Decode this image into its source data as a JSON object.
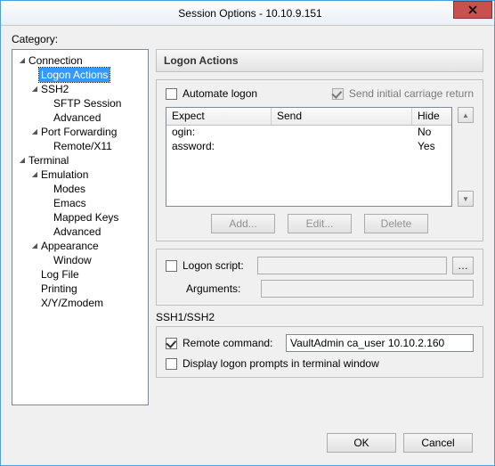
{
  "window": {
    "title": "Session Options - 10.10.9.151"
  },
  "category_label": "Category:",
  "tree": [
    {
      "label": "Connection",
      "level": 0,
      "arrow": "down"
    },
    {
      "label": "Logon Actions",
      "level": 1,
      "arrow": "",
      "selected": true
    },
    {
      "label": "SSH2",
      "level": 1,
      "arrow": "down"
    },
    {
      "label": "SFTP Session",
      "level": 2,
      "arrow": ""
    },
    {
      "label": "Advanced",
      "level": 2,
      "arrow": ""
    },
    {
      "label": "Port Forwarding",
      "level": 1,
      "arrow": "down"
    },
    {
      "label": "Remote/X11",
      "level": 2,
      "arrow": ""
    },
    {
      "label": "Terminal",
      "level": 0,
      "arrow": "down"
    },
    {
      "label": "Emulation",
      "level": 1,
      "arrow": "down"
    },
    {
      "label": "Modes",
      "level": 2,
      "arrow": ""
    },
    {
      "label": "Emacs",
      "level": 2,
      "arrow": ""
    },
    {
      "label": "Mapped Keys",
      "level": 2,
      "arrow": ""
    },
    {
      "label": "Advanced",
      "level": 2,
      "arrow": ""
    },
    {
      "label": "Appearance",
      "level": 1,
      "arrow": "down"
    },
    {
      "label": "Window",
      "level": 2,
      "arrow": ""
    },
    {
      "label": "Log File",
      "level": 1,
      "arrow": ""
    },
    {
      "label": "Printing",
      "level": 1,
      "arrow": ""
    },
    {
      "label": "X/Y/Zmodem",
      "level": 1,
      "arrow": ""
    }
  ],
  "pane_title": "Logon Actions",
  "automate_logon": {
    "label": "Automate logon",
    "checked": false
  },
  "send_initial": {
    "label": "Send initial carriage return",
    "checked": true,
    "disabled": true
  },
  "table": {
    "headers": {
      "expect": "Expect",
      "send": "Send",
      "hide": "Hide"
    },
    "rows": [
      {
        "expect": "ogin:",
        "send": "",
        "hide": "No"
      },
      {
        "expect": "assword:",
        "send": "",
        "hide": "Yes"
      }
    ]
  },
  "buttons": {
    "add": "Add...",
    "edit": "Edit...",
    "delete": "Delete"
  },
  "logon_script": {
    "label": "Logon script:",
    "value": "",
    "args_label": "Arguments:",
    "args_value": ""
  },
  "ssh_section": {
    "title": "SSH1/SSH2",
    "remote_label": "Remote command:",
    "remote_checked": true,
    "remote_value": "VaultAdmin ca_user 10.10.2.160",
    "display_prompts_label": "Display logon prompts in terminal window",
    "display_prompts_checked": false
  },
  "footer": {
    "ok": "OK",
    "cancel": "Cancel"
  }
}
